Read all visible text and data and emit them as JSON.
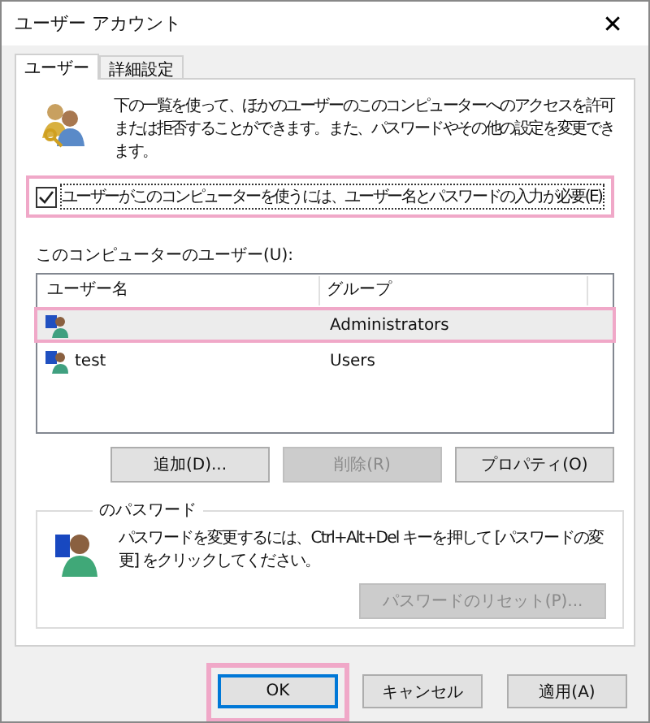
{
  "window": {
    "title": "ユーザー アカウント",
    "close": "✕"
  },
  "tabs": [
    {
      "label": "ユーザー",
      "selected": true
    },
    {
      "label": "詳細設定",
      "selected": false
    }
  ],
  "intro": "下の一覧を使って、ほかのユーザーのこのコンピューターへのアクセスを許可または拒否することができます。また、パスワードやその他の設定を変更できます。",
  "require_password": {
    "label": "ユーザーがこのコンピューターを使うには、ユーザー名とパスワードの入力が必要(E)",
    "checked": true,
    "highlighted": true
  },
  "users_label": "このコンピューターのユーザー(U):",
  "table": {
    "columns": [
      "ユーザー名",
      "グループ"
    ],
    "rows": [
      {
        "group": "Administrators",
        "selected": true,
        "highlighted": true
      },
      {
        "name": "test",
        "group": "Users",
        "selected": false,
        "highlighted": false
      }
    ]
  },
  "user_buttons": [
    {
      "label": "追加(D)...",
      "disabled": false
    },
    {
      "label": "削除(R)",
      "disabled": true
    },
    {
      "label": "プロパティ(O)",
      "disabled": false
    }
  ],
  "password_group": {
    "legend": "のパスワード",
    "text": "パスワードを変更するには、Ctrl+Alt+Del キーを押して [パスワードの変更] をクリックしてください。",
    "reset_button": {
      "label": "パスワードのリセット(P)...",
      "disabled": true
    }
  },
  "dialog_buttons": [
    {
      "label": "OK",
      "default": true,
      "highlighted": true
    },
    {
      "label": "キャンセル",
      "default": false,
      "highlighted": false
    },
    {
      "label": "適用(A)",
      "default": false,
      "highlighted": false
    }
  ]
}
